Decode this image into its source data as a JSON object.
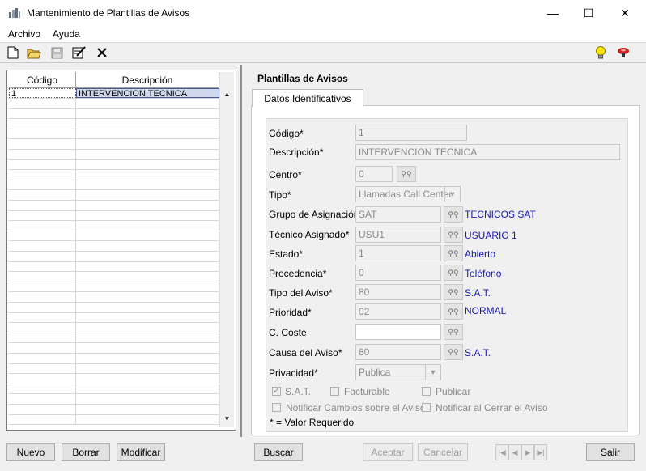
{
  "window": {
    "title": "Mantenimiento de Plantillas de Avisos",
    "minimize": "—",
    "maximize": "☐",
    "close": "✕"
  },
  "menu": {
    "items": [
      "Archivo",
      "Ayuda"
    ]
  },
  "toolbar": {
    "icons": [
      "new-file-icon",
      "open-folder-icon",
      "save-icon",
      "edit-icon",
      "delete-icon",
      "lightbulb-icon",
      "help-icon"
    ]
  },
  "grid": {
    "columns": [
      "Código",
      "Descripción"
    ],
    "rows": [
      {
        "codigo": "1",
        "descripcion": "INTERVENCION TECNICA"
      }
    ]
  },
  "panel": {
    "title": "Plantillas de Avisos",
    "tab": "Datos Identificativos"
  },
  "form": {
    "codigo": {
      "label": "Código*",
      "value": "1"
    },
    "descripcion": {
      "label": "Descripción*",
      "value": "INTERVENCION TECNICA"
    },
    "centro": {
      "label": "Centro*",
      "value": "0"
    },
    "tipo": {
      "label": "Tipo*",
      "value": "Llamadas Call Center"
    },
    "grupo": {
      "label": "Grupo de Asignación*",
      "value": "SAT",
      "desc": "TECNICOS SAT"
    },
    "tecnico": {
      "label": "Técnico Asignado*",
      "value": "USU1",
      "desc": "USUARIO 1"
    },
    "estado": {
      "label": "Estado*",
      "value": "1",
      "desc": "Abierto"
    },
    "procedencia": {
      "label": "Procedencia*",
      "value": "0",
      "desc": "Teléfono"
    },
    "tipo_aviso": {
      "label": "Tipo del Aviso*",
      "value": "80",
      "desc": "S.A.T."
    },
    "prioridad": {
      "label": "Prioridad*",
      "value": "02",
      "desc": "NORMAL"
    },
    "coste": {
      "label": "C. Coste",
      "value": ""
    },
    "causa": {
      "label": "Causa del Aviso*",
      "value": "80",
      "desc": "S.A.T."
    },
    "privacidad": {
      "label": "Privacidad*",
      "value": "Publica"
    },
    "checks": {
      "sat": {
        "label": "S.A.T.",
        "checked": true
      },
      "facturable": {
        "label": "Facturable",
        "checked": false
      },
      "publicar": {
        "label": "Publicar",
        "checked": false
      },
      "notificar_cambios": {
        "label": "Notificar Cambios sobre el Aviso",
        "checked": false
      },
      "notificar_cerrar": {
        "label": "Notificar al Cerrar el Aviso",
        "checked": false
      }
    },
    "note": "* = Valor Requerido"
  },
  "buttons": {
    "nuevo": "Nuevo",
    "borrar": "Borrar",
    "modificar": "Modificar",
    "buscar": "Buscar",
    "aceptar": "Aceptar",
    "cancelar": "Cancelar",
    "salir": "Salir"
  },
  "colors": {
    "description_link": "#1a1ab0",
    "selected_row": "#cfd8ec"
  }
}
